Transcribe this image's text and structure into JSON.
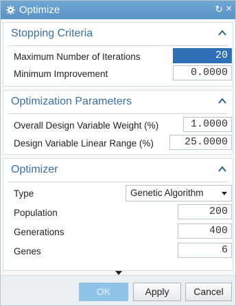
{
  "dialog": {
    "title": "Optimize",
    "reset_glyph": "↻",
    "close_glyph": "×"
  },
  "stopping_criteria": {
    "heading": "Stopping Criteria",
    "max_iterations_label": "Maximum Number of Iterations",
    "max_iterations_value": "20",
    "min_improvement_label": "Minimum Improvement",
    "min_improvement_value": "0.0000"
  },
  "optimization_parameters": {
    "heading": "Optimization Parameters",
    "weight_label": "Overall Design Variable Weight (%)",
    "weight_value": "1.0000",
    "range_label": "Design Variable Linear Range (%)",
    "range_value": "25.0000"
  },
  "optimizer": {
    "heading": "Optimizer",
    "type_label": "Type",
    "type_value": "Genetic Algorithm",
    "population_label": "Population",
    "population_value": "200",
    "generations_label": "Generations",
    "generations_value": "400",
    "genes_label": "Genes",
    "genes_value": "6"
  },
  "footer": {
    "ok_label": "OK",
    "apply_label": "Apply",
    "cancel_label": "Cancel"
  },
  "icons": {
    "title_icon": "gear-icon",
    "collapse_icon": "chevron-up-icon",
    "more_icon": "triangle-down-icon"
  },
  "colors": {
    "titlebar": "#5f98c8",
    "section_heading": "#3a6f9f",
    "selection": "#2f6fb5"
  }
}
